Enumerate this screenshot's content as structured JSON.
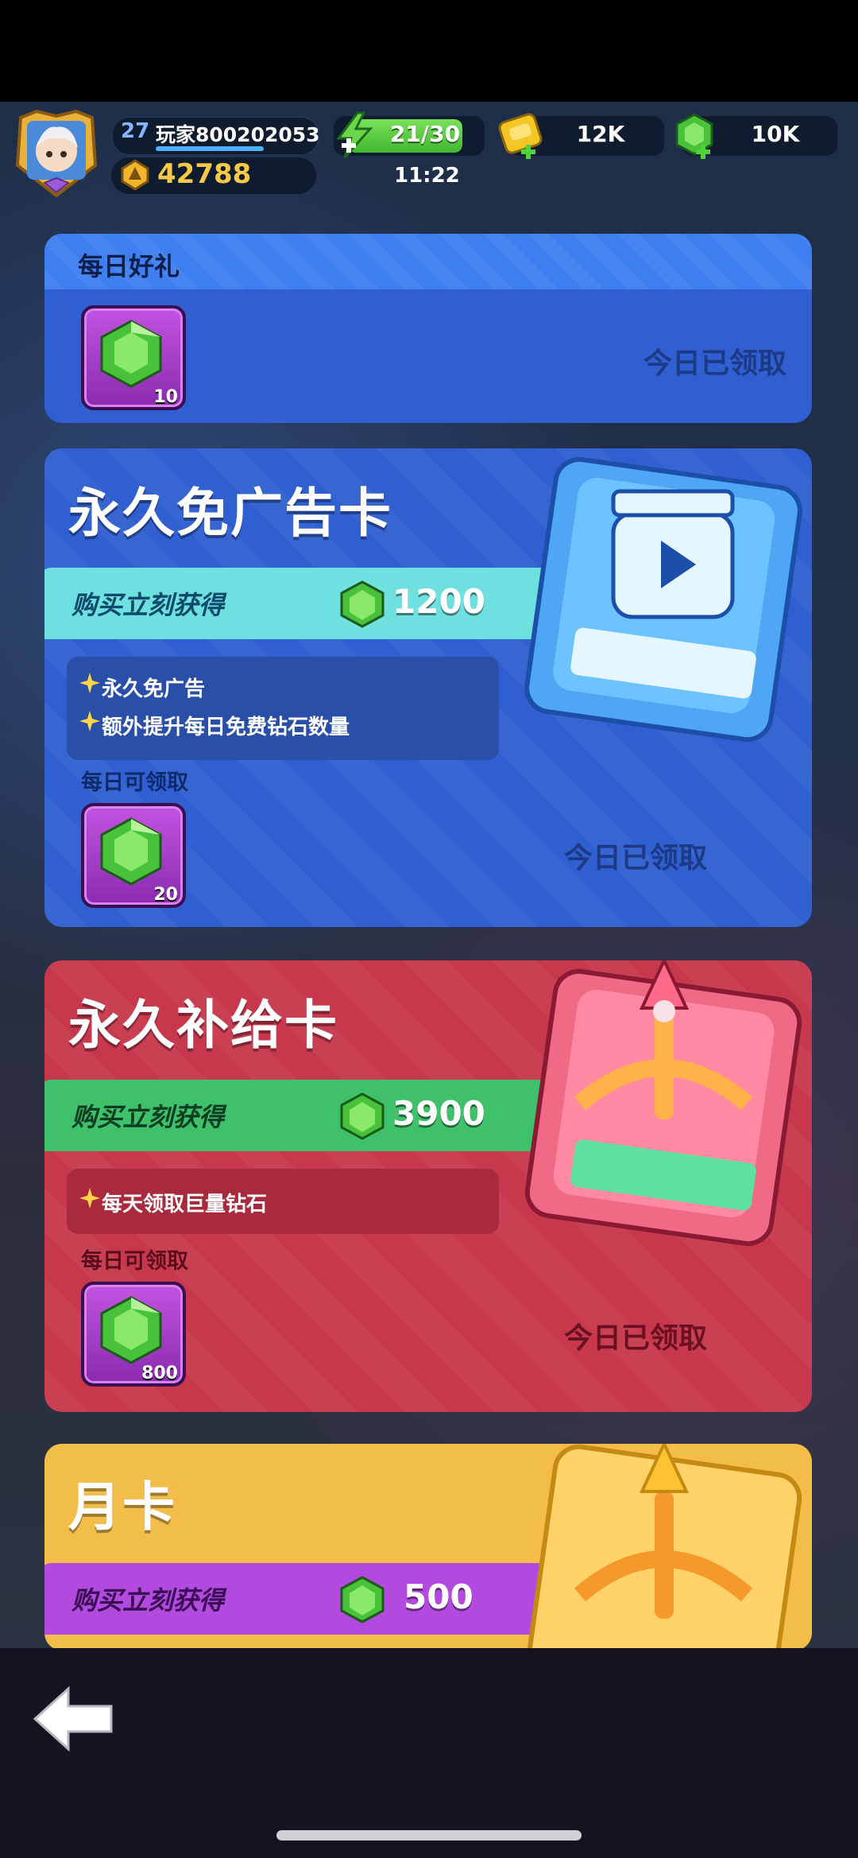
{
  "hud": {
    "level": "27",
    "player_name": "玩家800202053",
    "trophies": "42788",
    "energy": "21/30",
    "timer": "11:22",
    "gold": "12K",
    "gems": "10K"
  },
  "daily_gift": {
    "title": "每日好礼",
    "reward_count": "10",
    "status": "今日已领取"
  },
  "no_ad_card": {
    "title": "永久免广告卡",
    "buy_label": "购买立刻获得",
    "buy_amount": "1200",
    "perks": [
      "永久免广告",
      "额外提升每日免费钻石数量"
    ],
    "daily_label": "每日可领取",
    "reward_count": "20",
    "status": "今日已领取"
  },
  "supply_card": {
    "title": "永久补给卡",
    "buy_label": "购买立刻获得",
    "buy_amount": "3900",
    "perks": [
      "每天领取巨量钻石"
    ],
    "daily_label": "每日可领取",
    "reward_count": "800",
    "status": "今日已领取"
  },
  "monthly_card": {
    "title": "月卡",
    "buy_label": "购买立刻获得",
    "buy_amount": "500"
  },
  "colors": {
    "gem_green": "#49c23b",
    "tile_purple": "#a23fcf",
    "blue_panel": "#2f5fd0",
    "red_panel": "#c8384c",
    "gold_panel": "#f3bd4a"
  }
}
